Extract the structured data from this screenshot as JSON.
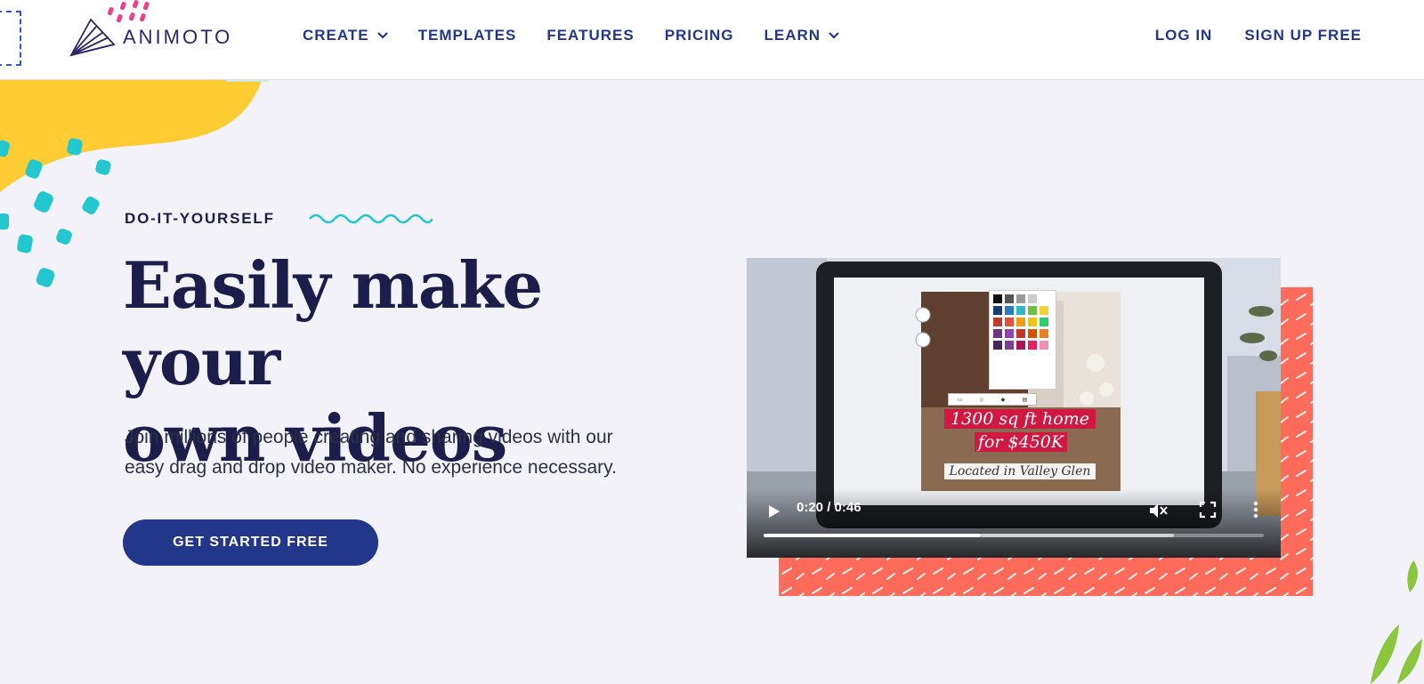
{
  "header": {
    "logo_text": "ANIMOTO",
    "nav": [
      {
        "label": "CREATE",
        "dropdown": true
      },
      {
        "label": "TEMPLATES",
        "dropdown": false
      },
      {
        "label": "FEATURES",
        "dropdown": false
      },
      {
        "label": "PRICING",
        "dropdown": false
      },
      {
        "label": "LEARN",
        "dropdown": true
      }
    ],
    "login_label": "LOG IN",
    "signup_label": "SIGN UP FREE"
  },
  "hero": {
    "eyebrow": "DO-IT-YOURSELF",
    "headline_line1": "Easily make your",
    "headline_line2": "own videos",
    "subtext_line1": "Join millions of people creating and sharing videos with our",
    "subtext_line2": "easy drag and drop video maker. No experience necessary.",
    "cta_label": "GET STARTED FREE"
  },
  "video": {
    "overlay_line1": "1300 sq ft home",
    "overlay_line2": "for $450K",
    "overlay_line3": "Located in Valley Glen",
    "time_display": "0:20 / 0:46",
    "progress_fraction": 0.4348,
    "buffered_fraction": 0.82,
    "muted": true
  },
  "colors": {
    "nav_text": "#23378a",
    "headline": "#1c1d4a",
    "cta_bg": "#23378a",
    "accent_yellow": "#ffcc33",
    "accent_teal": "#22c7cf",
    "accent_coral": "#ff6b5b",
    "accent_pink": "#ee3f8c",
    "accent_green": "#8cc63f"
  },
  "icons": {
    "logo": "animoto-fan-logo-icon",
    "chevron": "chevron-down-icon",
    "play": "play-icon",
    "mute": "volume-muted-icon",
    "fullscreen": "fullscreen-icon",
    "more": "more-vertical-icon"
  }
}
